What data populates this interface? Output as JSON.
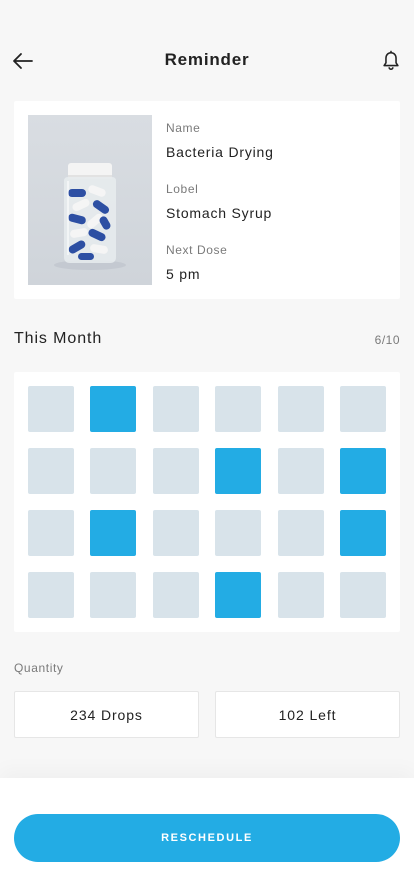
{
  "header": {
    "title": "Reminder",
    "back_icon": "arrow-left-icon",
    "notification_icon": "bell-icon"
  },
  "medication": {
    "image_icon": "pill-bottle-image",
    "name_label": "Name",
    "name_value": "Bacteria Drying",
    "label_label": "Lobel",
    "label_value": "Stomach Syrup",
    "next_dose_label": "Next Dose",
    "next_dose_value": "5 pm"
  },
  "month": {
    "title": "This Month",
    "progress": "6/10",
    "days": [
      false,
      true,
      false,
      false,
      false,
      false,
      false,
      false,
      false,
      true,
      false,
      true,
      false,
      true,
      false,
      false,
      false,
      true,
      false,
      false,
      false,
      true,
      false,
      false
    ]
  },
  "quantity": {
    "label": "Quantity",
    "drops": "234 Drops",
    "left": "102 Left"
  },
  "actions": {
    "reschedule_label": "RESCHEDULE"
  },
  "colors": {
    "accent": "#23ace4",
    "cell_default": "#d8e3ea",
    "background": "#f7f7f7"
  }
}
